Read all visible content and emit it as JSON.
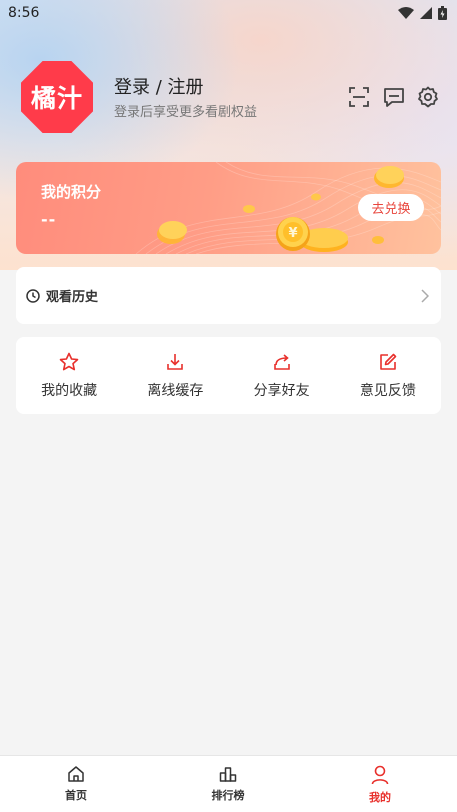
{
  "status_bar": {
    "time": "8:56"
  },
  "profile": {
    "logo_text": "橘汁",
    "login_label": "登录 / 注册",
    "login_subtitle": "登录后享受更多看剧权益"
  },
  "header_icons": [
    "scan-icon",
    "message-icon",
    "settings-icon"
  ],
  "points": {
    "title": "我的积分",
    "value": "--",
    "redeem_label": "去兑换"
  },
  "history": {
    "label": "观看历史"
  },
  "actions": [
    {
      "label": "我的收藏",
      "icon": "star-icon"
    },
    {
      "label": "离线缓存",
      "icon": "download-icon"
    },
    {
      "label": "分享好友",
      "icon": "share-icon"
    },
    {
      "label": "意见反馈",
      "icon": "feedback-icon"
    }
  ],
  "tabs": [
    {
      "label": "首页",
      "icon": "home-icon",
      "active": false
    },
    {
      "label": "排行榜",
      "icon": "ranking-icon",
      "active": false
    },
    {
      "label": "我的",
      "icon": "profile-icon",
      "active": true
    }
  ],
  "colors": {
    "accent": "#e8302c",
    "logo_bg": "#ff3b4a",
    "points_card_start": "#ff8c7c",
    "points_card_end": "#ffc29e",
    "page_bg": "#f4f4f4"
  }
}
